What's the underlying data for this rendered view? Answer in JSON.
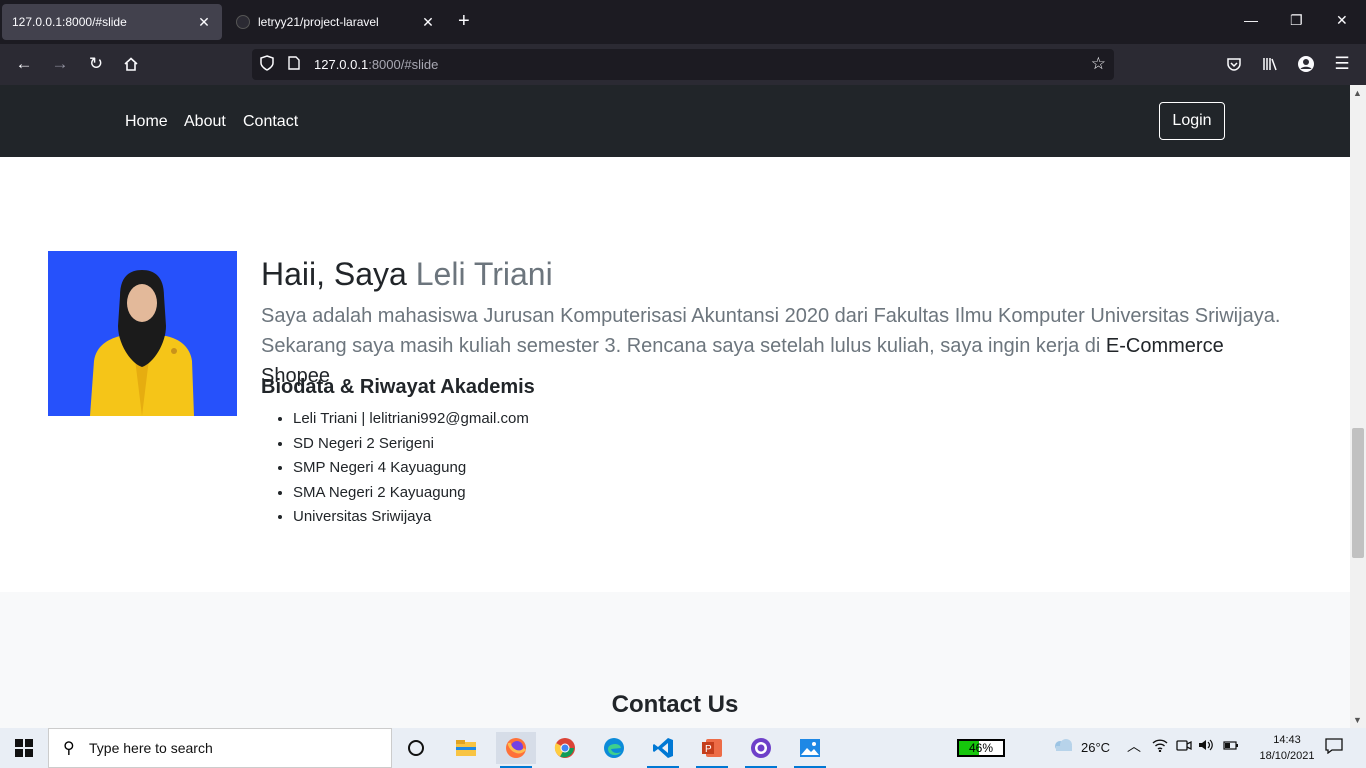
{
  "browser": {
    "tabs": [
      {
        "title": "127.0.0.1:8000/#slide",
        "active": true
      },
      {
        "title": "letryy21/project-laravel",
        "active": false
      }
    ],
    "url_host": "127.0.0.1",
    "url_rest": ":8000/#slide"
  },
  "site": {
    "nav": [
      "Home",
      "About",
      "Contact"
    ],
    "login_label": "Login",
    "greeting": "Haii, Saya ",
    "name": "Leli Triani",
    "intro_text": "Saya adalah mahasiswa Jurusan Komputerisasi Akuntansi 2020 dari Fakultas Ilmu Komputer Universitas Sriwijaya. Sekarang saya masih kuliah semester 3. Rencana saya setelah lulus kuliah, saya ingin kerja di ",
    "intro_highlight": "E-Commerce Shopee",
    "bio_title": "Biodata & Riwayat Akademis",
    "bio_items": [
      "Leli Triani | lelitriani992@gmail.com",
      "SD Negeri 2 Serigeni",
      "SMP Negeri 4 Kayuagung",
      "SMA Negeri 2 Kayuagung",
      "Universitas Sriwijaya"
    ],
    "contact_title": "Contact Us"
  },
  "taskbar": {
    "search_placeholder": "Type here to search",
    "battery_percent": 46,
    "battery_label": "46%",
    "temperature": "26°C",
    "time": "14:43",
    "date": "18/10/2021"
  },
  "colors": {
    "site_nav_bg": "#212529",
    "photo_bg": "#2651fb",
    "jacket": "#f5c518",
    "battery_fill": "#16c60c"
  }
}
